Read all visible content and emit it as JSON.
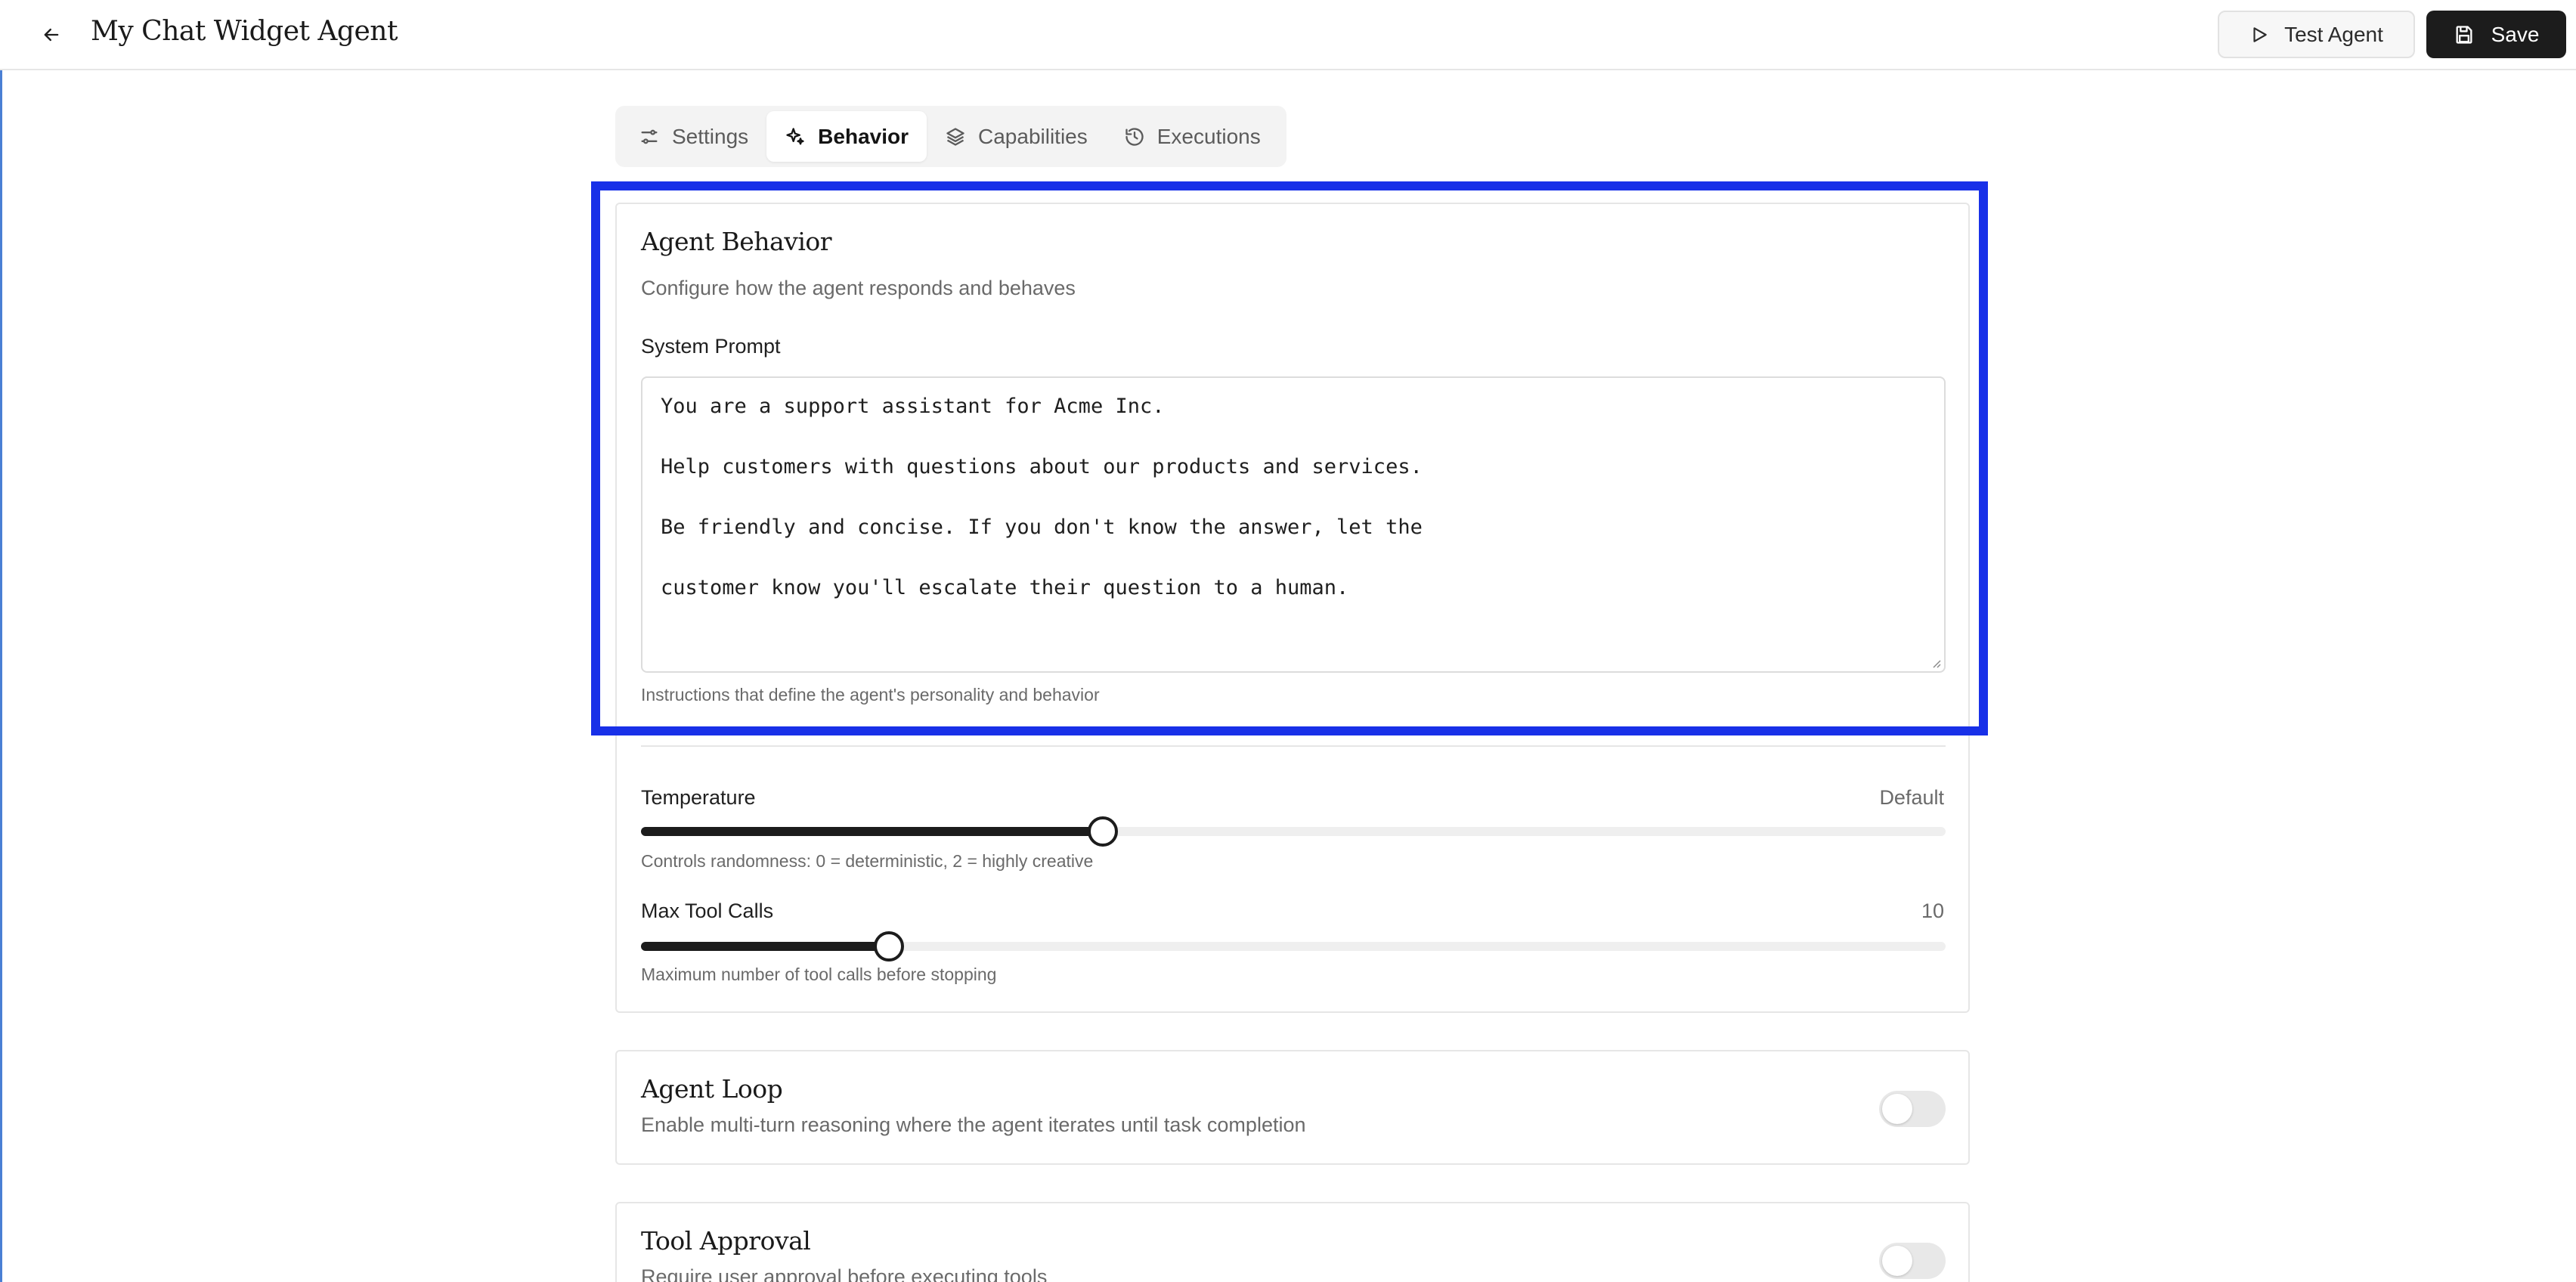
{
  "header": {
    "title": "My Chat Widget Agent",
    "test_label": "Test Agent",
    "save_label": "Save"
  },
  "tabs": [
    {
      "label": "Settings",
      "icon": "sliders-icon"
    },
    {
      "label": "Behavior",
      "icon": "sparkles-icon",
      "active": true
    },
    {
      "label": "Capabilities",
      "icon": "layers-icon"
    },
    {
      "label": "Executions",
      "icon": "history-icon"
    }
  ],
  "behavior": {
    "title": "Agent Behavior",
    "subtitle": "Configure how the agent responds and behaves",
    "system_prompt": {
      "label": "System Prompt",
      "lines": [
        "You are a support assistant for Acme Inc.",
        "Help customers with questions about our products and services.",
        "Be friendly and concise. If you don't know the answer, let the",
        "customer know you'll escalate their question to a human."
      ],
      "helper": "Instructions that define the agent's personality and behavior"
    },
    "temperature": {
      "label": "Temperature",
      "value_text": "Default",
      "level": 0.354,
      "helper": "Controls randomness: 0 = deterministic, 2 = highly creative"
    },
    "max_tool_calls": {
      "label": "Max Tool Calls",
      "value_text": "10",
      "level": 0.19,
      "helper": "Maximum number of tool calls before stopping"
    }
  },
  "agent_loop": {
    "title": "Agent Loop",
    "subtitle": "Enable multi-turn reasoning where the agent iterates until task completion",
    "enabled": false
  },
  "tool_approval": {
    "title": "Tool Approval",
    "subtitle": "Require user approval before executing tools",
    "enabled": false
  },
  "colors": {
    "highlight": "#1830e8",
    "primary": "#1c1c1c"
  }
}
